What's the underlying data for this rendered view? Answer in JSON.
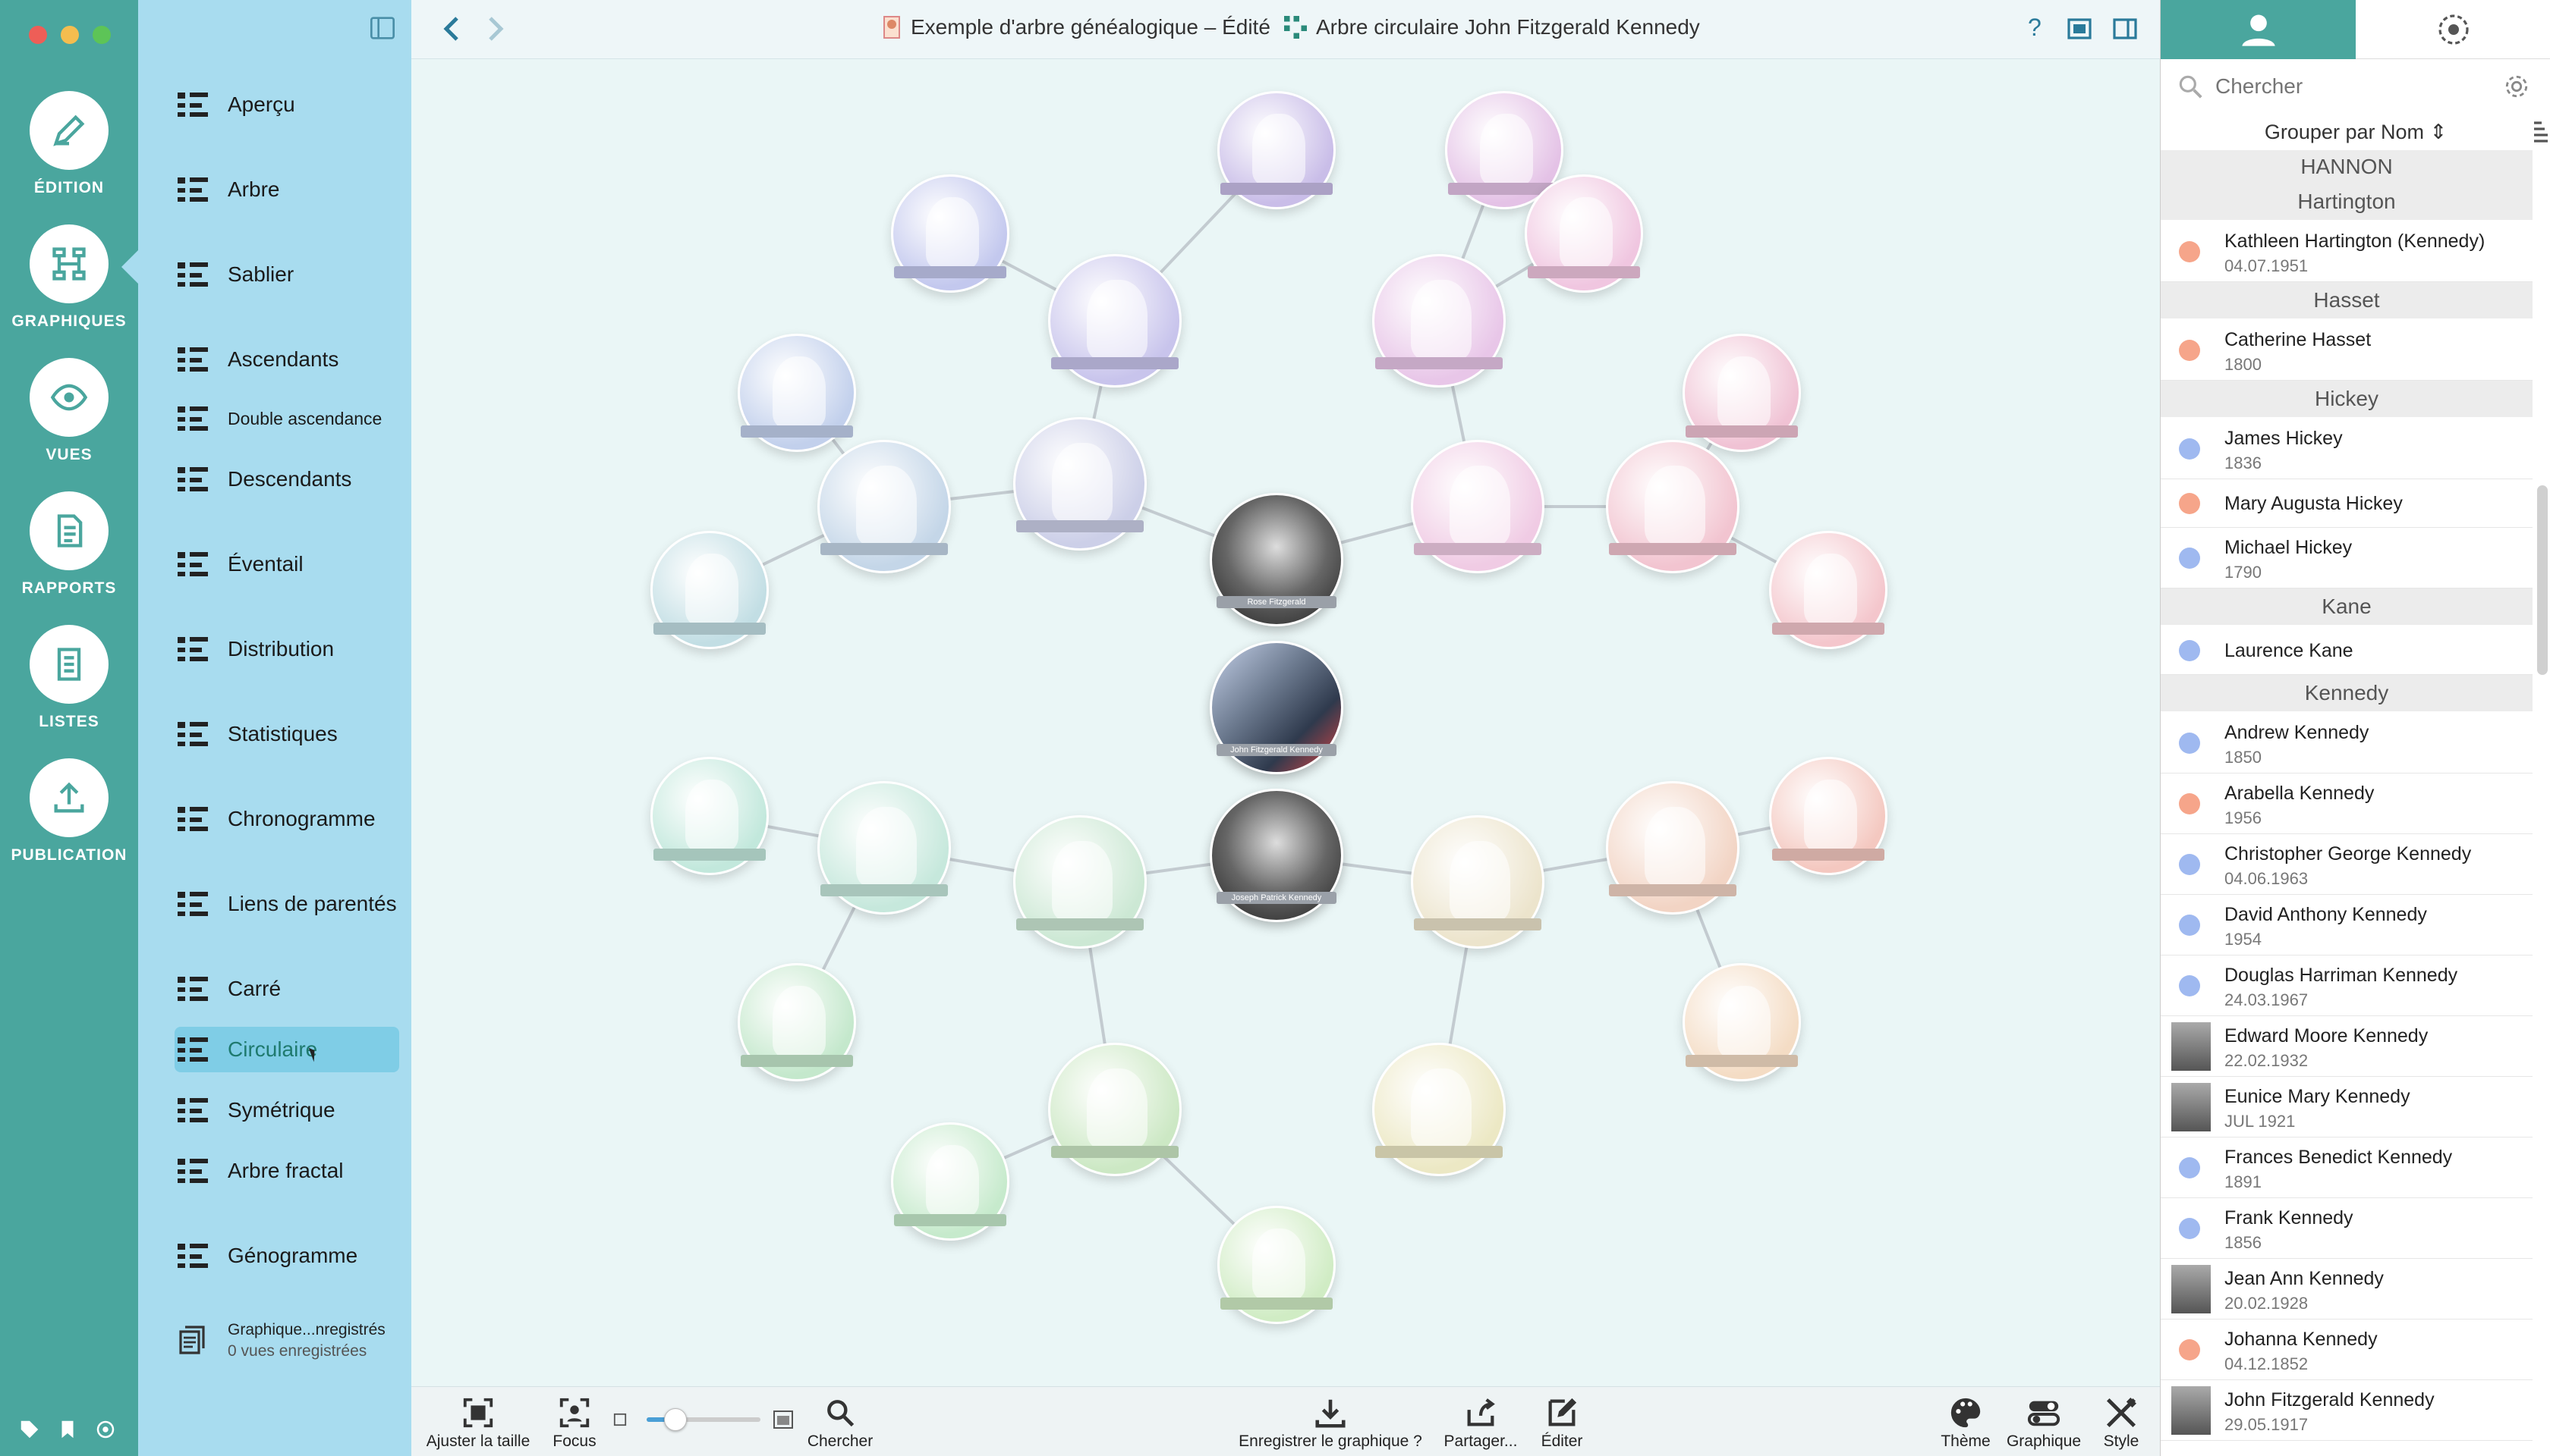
{
  "rail": {
    "items": [
      {
        "label": "ÉDITION",
        "icon": "pencil-icon"
      },
      {
        "label": "GRAPHIQUES",
        "icon": "chart-tree-icon"
      },
      {
        "label": "VUES",
        "icon": "eye-icon"
      },
      {
        "label": "RAPPORTS",
        "icon": "report-icon"
      },
      {
        "label": "LISTES",
        "icon": "list-icon"
      },
      {
        "label": "PUBLICATION",
        "icon": "upload-icon"
      }
    ]
  },
  "menu": {
    "items": [
      {
        "label": "Aperçu",
        "icon": "grid-icon"
      },
      {
        "label": "Arbre",
        "icon": "tree-icon"
      },
      {
        "label": "Sablier",
        "icon": "hourglass-icon"
      },
      {
        "label": "Ascendants",
        "icon": "ascendants-icon"
      },
      {
        "label": "Double ascendance",
        "icon": "double-ascendance-icon"
      },
      {
        "label": "Descendants",
        "icon": "descendants-icon"
      },
      {
        "label": "Éventail",
        "icon": "fan-icon"
      },
      {
        "label": "Distribution",
        "icon": "distribution-icon"
      },
      {
        "label": "Statistiques",
        "icon": "bar-chart-icon"
      },
      {
        "label": "Chronogramme",
        "icon": "timeline-icon"
      },
      {
        "label": "Liens de parentés",
        "icon": "relations-icon"
      },
      {
        "label": "Carré",
        "icon": "square-icon"
      },
      {
        "label": "Circulaire",
        "icon": "circular-icon"
      },
      {
        "label": "Symétrique",
        "icon": "symmetric-icon"
      },
      {
        "label": "Arbre fractal",
        "icon": "fractal-icon"
      },
      {
        "label": "Génogramme",
        "icon": "genogram-icon"
      }
    ],
    "saved_title": "Graphique...nregistrés",
    "saved_sub": "0 vues enregistrées"
  },
  "topbar": {
    "doc_title": "Exemple d'arbre généalogique – Édité",
    "chart_title": "Arbre circulaire John Fitzgerald Kennedy",
    "help": "?"
  },
  "bottombar": {
    "fit": "Ajuster la taille",
    "focus": "Focus",
    "search": "Chercher",
    "save": "Enregistrer le graphique ?",
    "share": "Partager...",
    "edit": "Éditer",
    "theme": "Thème",
    "graph": "Graphique",
    "style": "Style",
    "zoom": 0.25
  },
  "right": {
    "search_placeholder": "Chercher",
    "groupby": "Grouper par Nom ⇕",
    "top_group": "HANNON",
    "groups": [
      {
        "name": "Hartington",
        "people": [
          {
            "name": "Kathleen Hartington (Kennedy)",
            "date": "04.07.1951",
            "sex": "f"
          }
        ]
      },
      {
        "name": "Hasset",
        "people": [
          {
            "name": "Catherine Hasset",
            "date": "1800",
            "sex": "f"
          }
        ]
      },
      {
        "name": "Hickey",
        "people": [
          {
            "name": "James Hickey",
            "date": "1836",
            "sex": "m"
          },
          {
            "name": "Mary Augusta Hickey",
            "date": "",
            "sex": "f"
          },
          {
            "name": "Michael Hickey",
            "date": "1790",
            "sex": "m"
          }
        ]
      },
      {
        "name": "Kane",
        "people": [
          {
            "name": "Laurence Kane",
            "date": "",
            "sex": "m"
          }
        ]
      },
      {
        "name": "Kennedy",
        "people": [
          {
            "name": "Andrew Kennedy",
            "date": "1850",
            "sex": "m"
          },
          {
            "name": "Arabella Kennedy",
            "date": "1956",
            "sex": "f"
          },
          {
            "name": "Christopher George Kennedy",
            "date": "04.06.1963",
            "sex": "m"
          },
          {
            "name": "David Anthony Kennedy",
            "date": "1954",
            "sex": "m"
          },
          {
            "name": "Douglas Harriman Kennedy",
            "date": "24.03.1967",
            "sex": "m"
          },
          {
            "name": "Edward Moore Kennedy",
            "date": "22.02.1932",
            "sex": "photo"
          },
          {
            "name": "Eunice Mary Kennedy",
            "date": "JUL 1921",
            "sex": "photo"
          },
          {
            "name": "Frances Benedict Kennedy",
            "date": "1891",
            "sex": "m"
          },
          {
            "name": "Frank Kennedy",
            "date": "1856",
            "sex": "m"
          },
          {
            "name": "Jean Ann Kennedy",
            "date": "20.02.1928",
            "sex": "photo"
          },
          {
            "name": "Johanna Kennedy",
            "date": "04.12.1852",
            "sex": "f"
          },
          {
            "name": "John Fitzgerald Kennedy",
            "date": "29.05.1917",
            "sex": "photo"
          }
        ]
      }
    ]
  },
  "tree": {
    "center": {
      "name": "John Fitzgerald Kennedy"
    },
    "mother": {
      "name": "Rose Fitzgerald"
    },
    "father": {
      "name": "Joseph Patrick Kennedy"
    }
  },
  "colors": {
    "rail": "#4aa69e",
    "menu": "#a8dcef",
    "accent": "#1f7a6e",
    "female": "#f6a58a",
    "male": "#9fb9f0"
  }
}
